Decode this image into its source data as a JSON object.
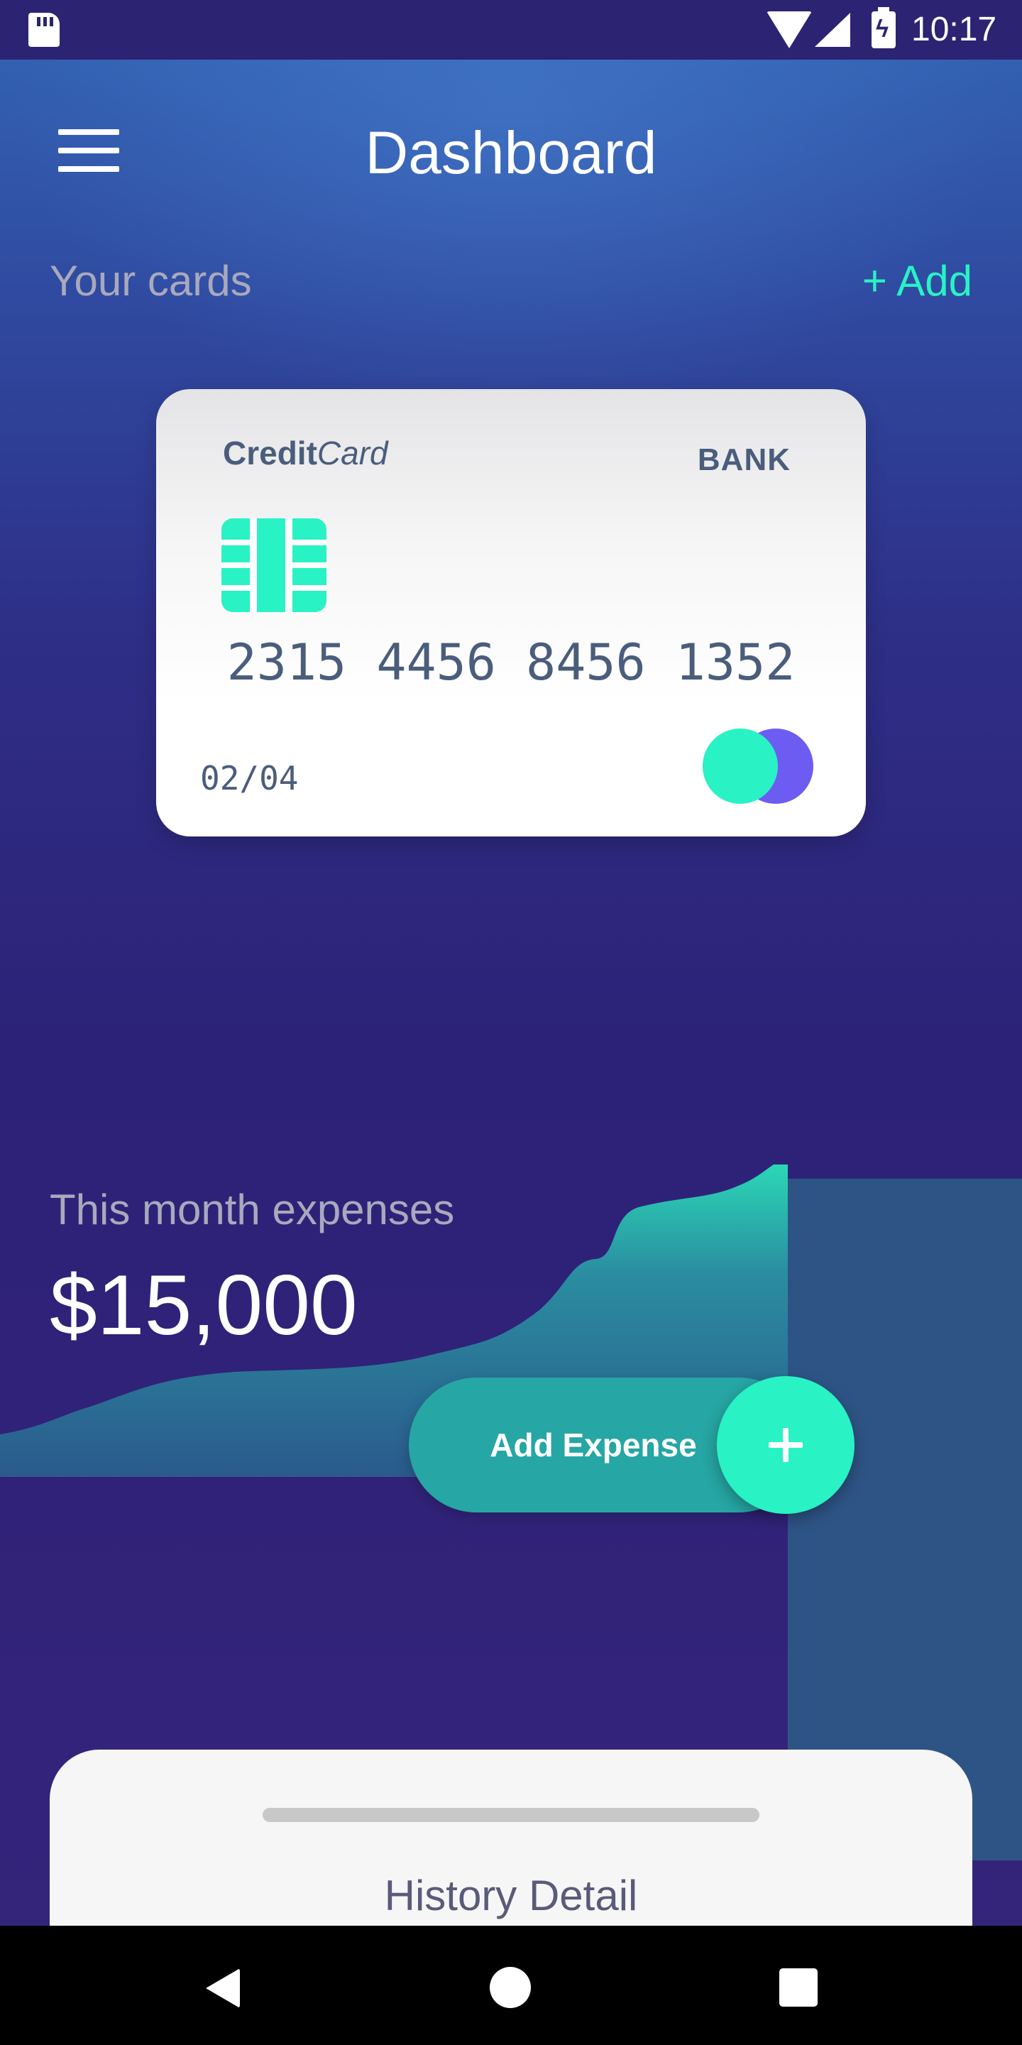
{
  "status_bar": {
    "time": "10:17"
  },
  "header": {
    "title": "Dashboard",
    "menu_icon": "hamburger-menu-icon"
  },
  "cards_section": {
    "label": "Your cards",
    "add_label": "+ Add"
  },
  "card": {
    "brand_bold": "Credit",
    "brand_italic": "Card",
    "bank": "BANK",
    "number": "2315 4456 8456 1352",
    "expiry": "02/04",
    "chip_icon": "chip-icon",
    "network_logo": "two-circles-logo"
  },
  "expenses": {
    "label": "This month expenses",
    "amount": "$15,000",
    "add_button_label": "Add Expense",
    "plus_icon": "plus-icon"
  },
  "history": {
    "title": "History Detail"
  },
  "colors": {
    "accent": "#29f2c4",
    "purple": "#6d5cf1",
    "card_text": "#4a5d7c",
    "background_top": "#3466b6",
    "background_bottom": "#2c2277"
  },
  "nav_bar": {
    "back_icon": "back-icon",
    "home_icon": "home-icon",
    "recents_icon": "recents-icon"
  }
}
